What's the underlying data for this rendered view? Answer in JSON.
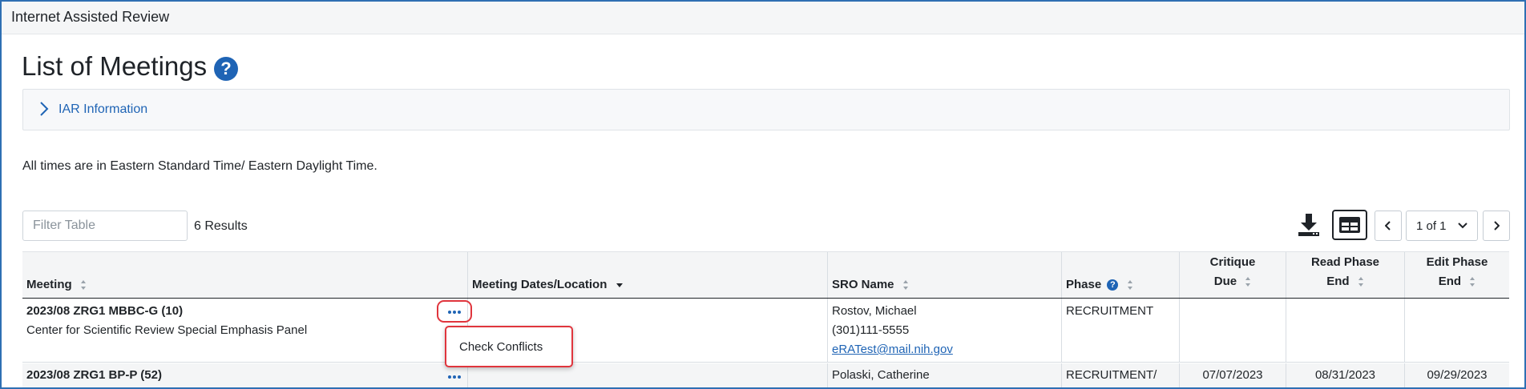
{
  "app": {
    "title": "Internet Assisted Review"
  },
  "page": {
    "title": "List of Meetings"
  },
  "accordion": {
    "label": "IAR Information"
  },
  "timezone_note": "All times are in Eastern Standard Time/ Eastern Daylight Time.",
  "filter": {
    "placeholder": "Filter Table",
    "value": ""
  },
  "results_text": "6 Results",
  "pagination": {
    "current": "1 of 1"
  },
  "table": {
    "headers": {
      "meeting": "Meeting",
      "dates": "Meeting Dates/Location",
      "sro": "SRO Name",
      "phase": "Phase",
      "critique_line1": "Critique",
      "critique_line2": "Due",
      "read_line1": "Read Phase",
      "read_line2": "End",
      "edit_line1": "Edit Phase",
      "edit_line2": "End"
    },
    "rows": [
      {
        "meeting_id": "2023/08 ZRG1 MBBC-G (10)",
        "meeting_name": "Center for Scientific Review Special Emphasis Panel",
        "sro_name": "Rostov, Michael",
        "sro_phone": "(301)111-5555",
        "sro_email": "eRATest@mail.nih.gov",
        "phase": "RECRUITMENT",
        "critique_due": "",
        "read_end": "",
        "edit_end": ""
      },
      {
        "meeting_id": "2023/08 ZRG1 BP-P (52)",
        "sro_name": "Polaski, Catherine",
        "phase": "RECRUITMENT/",
        "critique_due": "07/07/2023",
        "read_end": "08/31/2023",
        "edit_end": "09/29/2023"
      }
    ]
  },
  "actions_menu": {
    "item": "Check Conflicts"
  },
  "colors": {
    "accent": "#1f64b5",
    "highlight": "#e0353d"
  }
}
